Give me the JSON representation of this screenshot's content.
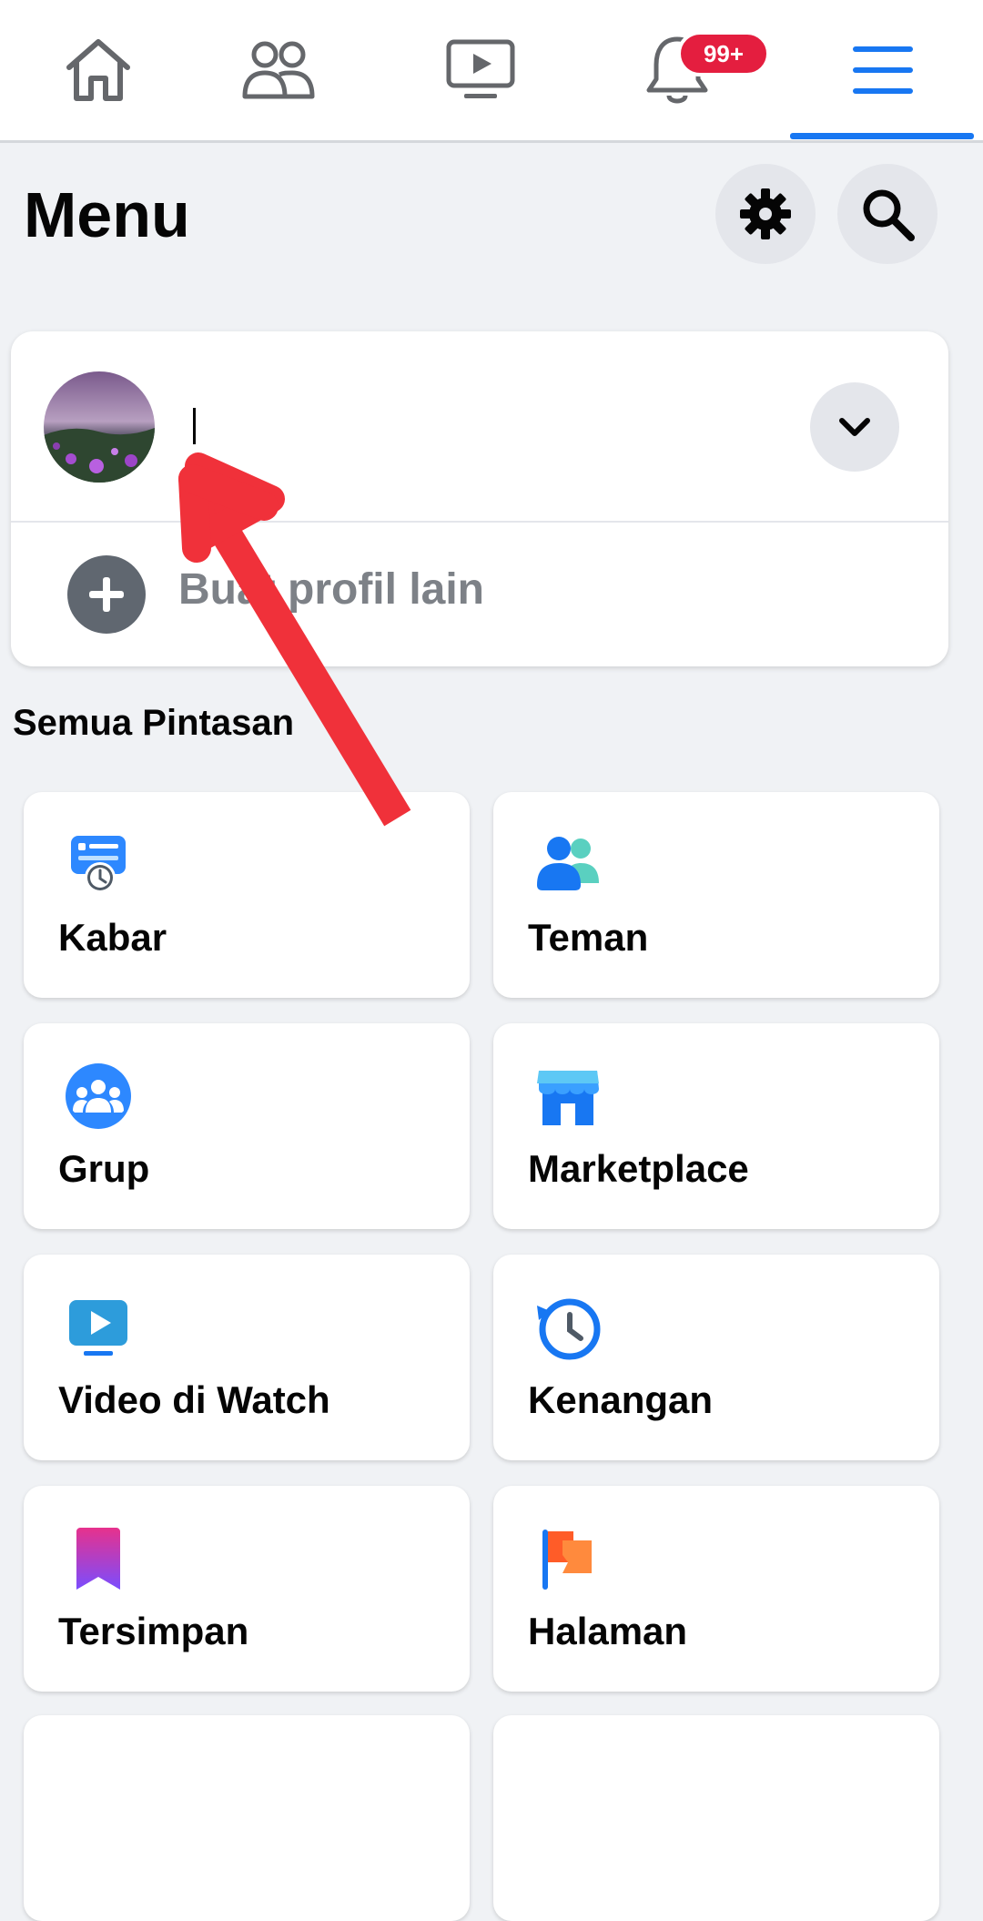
{
  "nav": {
    "items": [
      {
        "name": "home",
        "icon": "home-icon"
      },
      {
        "name": "friends",
        "icon": "people-icon"
      },
      {
        "name": "watch",
        "icon": "video-icon"
      },
      {
        "name": "notifications",
        "icon": "bell-icon"
      },
      {
        "name": "menu",
        "icon": "hamburger-icon",
        "active": true
      }
    ],
    "notification_badge": "99+",
    "accent_color": "#1877f2",
    "badge_color": "#e41e3f"
  },
  "header": {
    "title": "Menu",
    "settings_icon": "gear-icon",
    "search_icon": "search-icon"
  },
  "profile": {
    "name": "",
    "expand_icon": "chevron-down-icon",
    "create_label": "Buat profil lain",
    "create_icon": "plus-circle-icon"
  },
  "shortcuts": {
    "title": "Semua Pintasan",
    "items": [
      {
        "label": "Kabar",
        "icon": "feed-icon"
      },
      {
        "label": "Teman",
        "icon": "friends-icon"
      },
      {
        "label": "Grup",
        "icon": "groups-icon"
      },
      {
        "label": "Marketplace",
        "icon": "marketplace-icon"
      },
      {
        "label": "Video di Watch",
        "icon": "watch-video-icon"
      },
      {
        "label": "Kenangan",
        "icon": "memories-icon"
      },
      {
        "label": "Tersimpan",
        "icon": "saved-icon"
      },
      {
        "label": "Halaman",
        "icon": "pages-flag-icon"
      }
    ]
  },
  "annotation": {
    "type": "red-arrow",
    "color": "#f0313a"
  }
}
